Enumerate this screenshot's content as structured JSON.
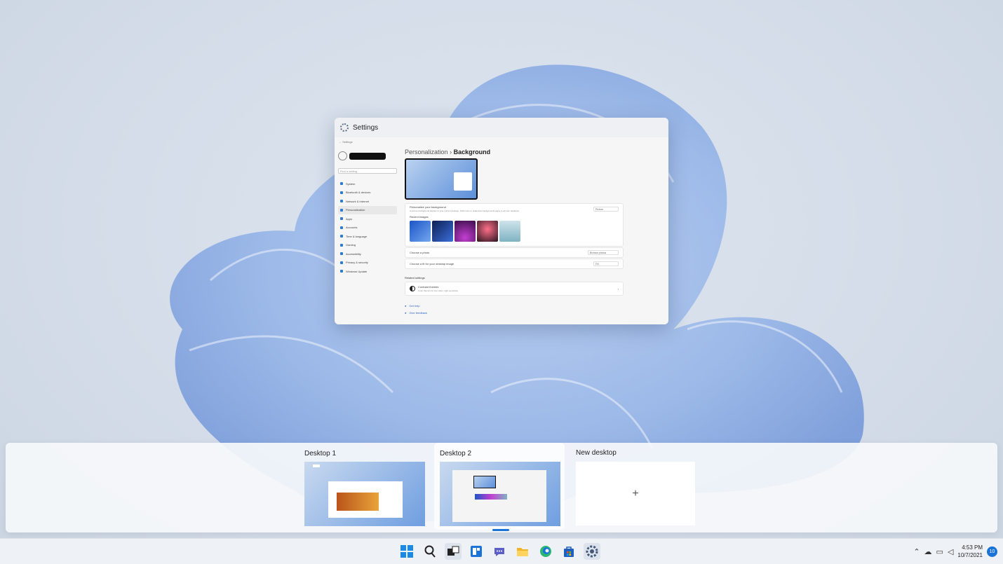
{
  "window": {
    "title": "Settings",
    "nav_title": "Settings",
    "find_placeholder": "Find a setting",
    "nav_items": [
      "System",
      "Bluetooth & devices",
      "Network & internet",
      "Personalization",
      "Apps",
      "Accounts",
      "Time & language",
      "Gaming",
      "Accessibility",
      "Privacy & security",
      "Windows Update"
    ],
    "active_nav_index": 3,
    "breadcrumb_parent": "Personalization",
    "breadcrumb_separator": "›",
    "breadcrumb_current": "Background",
    "personalize_label": "Personalize your background",
    "personalize_desc": "A picture background applies to your current desktop. Solid color or slideshow backgrounds apply to all your desktops.",
    "personalize_value": "Picture",
    "recent_images_label": "Recent images",
    "choose_photo_label": "Choose a photo",
    "browse_label": "Browse photos",
    "fit_label": "Choose a fit for your desktop image",
    "fit_value": "Fill",
    "related_settings": "Related settings",
    "contrast_title": "Contrast themes",
    "contrast_desc": "Color themes for low vision, light sensitivity",
    "get_help": "Get help",
    "give_feedback": "Give feedback"
  },
  "task_view": {
    "desktops": [
      {
        "label": "Desktop 1"
      },
      {
        "label": "Desktop 2"
      },
      {
        "label": "New desktop"
      }
    ],
    "new_desktop_symbol": "+"
  },
  "taskbar": {
    "apps": [
      "start-icon",
      "search-icon",
      "task-view-icon",
      "widgets-icon",
      "chat-icon",
      "file-explorer-icon",
      "edge-icon",
      "store-icon",
      "settings-icon"
    ],
    "time": "4:53 PM",
    "date": "10/7/2021",
    "notification_count": "10"
  },
  "colors": {
    "accent": "#1a73d6",
    "wallpaper": "#d3dce8"
  }
}
